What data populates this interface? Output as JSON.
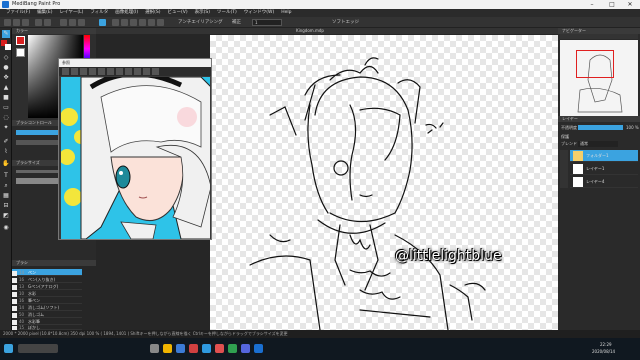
{
  "window": {
    "title": "MediBang Paint Pro"
  },
  "menu": [
    "ファイル(F)",
    "編集(E)",
    "レイヤー(L)",
    "フィルタ",
    "画像処理(I)",
    "選択(S)",
    "ビュー(V)",
    "表示(S)",
    "ツール(T)",
    "ウィンドウ(W)",
    "Help"
  ],
  "toolbar": {
    "antialias_label": "アンチエイリアシング",
    "mode_label": "補正",
    "mode_value": "1",
    "stroke_label": "ソフトエッジ"
  },
  "canvas_tab": {
    "label": "Kingdom.mdp"
  },
  "panels": {
    "color": "カラー",
    "brush_control": "ブラシコントロール",
    "brush_size": "ブラシサイズ",
    "brush": "ブラシ",
    "navigator": "ナビゲーター",
    "layer": "レイヤー"
  },
  "ref_window": {
    "title": "参照"
  },
  "brushes": [
    {
      "num": "14",
      "label": "ペン"
    },
    {
      "num": "16",
      "label": "ペン(入り抜き)"
    },
    {
      "num": "13",
      "label": "Gペン(アナログ)"
    },
    {
      "num": "10",
      "label": "水彩"
    },
    {
      "num": "16",
      "label": "筆ペン"
    },
    {
      "num": "14",
      "label": "消しゴム(ソフト)"
    },
    {
      "num": "50",
      "label": "消しゴム"
    },
    {
      "num": "40",
      "label": "水彩筆"
    },
    {
      "num": "15",
      "label": "ぼかし"
    }
  ],
  "layer": {
    "opacity_label": "不透明度",
    "opacity_value": "100 %",
    "blend_label": "ブレンド",
    "blend_value": "通常",
    "protect_label": "保護",
    "rows": [
      {
        "name": "フォルダー1",
        "selected": true
      },
      {
        "name": "レイヤー1",
        "selected": false
      },
      {
        "name": "レイヤー4",
        "selected": false
      }
    ]
  },
  "status": {
    "text": "2000 * 2000 pixel  (10.8*10.8cm)  350 dpi  100 %  ( 1894, 1401 )  Shiftキーを押しながら直線を描く  Ctrlキーを押しながらドラッグでブラシサイズを変更"
  },
  "watermark": {
    "text": "@littlelightblue"
  },
  "clock": {
    "time": "22:29",
    "date": "2020/08/14"
  },
  "colors": {
    "accent": "#3ba3e0",
    "art_bg": "#2ec3e8",
    "fg_swatch": "#d82020"
  }
}
